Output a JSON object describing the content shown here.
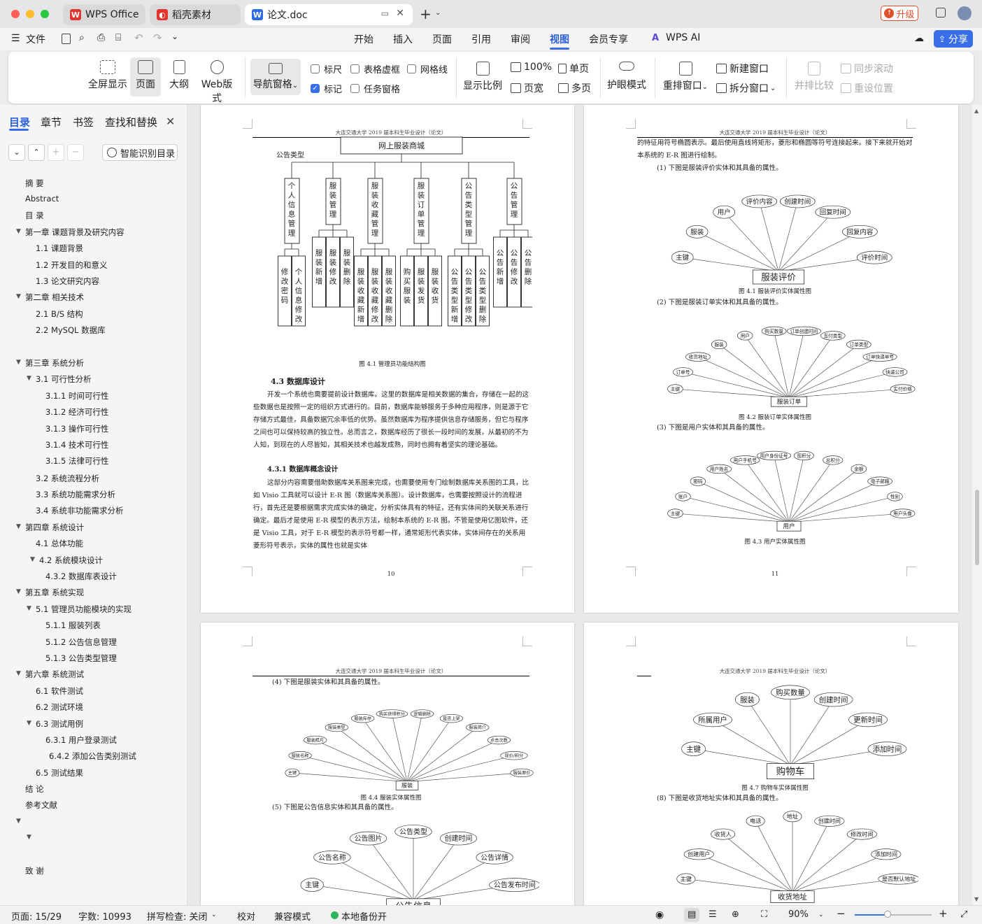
{
  "tabs": [
    {
      "label": "WPS Office"
    },
    {
      "label": "稻壳素材"
    },
    {
      "label": "论文.doc"
    }
  ],
  "upgrade_label": "升级",
  "menu": {
    "file": "文件",
    "items": [
      "开始",
      "插入",
      "页面",
      "引用",
      "审阅",
      "视图",
      "会员专享"
    ],
    "wps_ai": "WPS AI",
    "share": "分享"
  },
  "ribbon": {
    "fullscreen": "全屏显示",
    "page": "页面",
    "outline": "大纲",
    "web": "Web版式",
    "navpane": "导航窗格",
    "ruler": "标尺",
    "table_grid": "表格虚框",
    "gridlines": "网格线",
    "markup": "标记",
    "taskpane": "任务窗格",
    "zoom": "显示比例",
    "zoom100": "100%",
    "pagewidth": "页宽",
    "singlepage": "单页",
    "multipage": "多页",
    "eyecare": "护眼模式",
    "arrange": "重排窗口",
    "newwindow": "新建窗口",
    "split": "拆分窗口",
    "sidebyside": "并排比较",
    "syncscroll": "同步滚动",
    "resetpos": "重设位置"
  },
  "sidebar": {
    "tabs": [
      "目录",
      "章节",
      "书签",
      "查找和替换"
    ],
    "smart": "智能识别目录",
    "toc": [
      "摘 要",
      "Abstract",
      "目 录",
      "第一章 课题背景及研究内容",
      "1.1 课题背景",
      "1.2 开发目的和意义",
      "1.3 论文研究内容",
      "第二章 相关技术",
      "2.1 B/S 结构",
      "2.2 MySQL 数据库",
      "第三章 系统分析",
      "3.1 可行性分析",
      "3.1.1 时间可行性",
      "3.1.2 经济可行性",
      "3.1.3 操作可行性",
      "3.1.4 技术可行性",
      "3.1.5 法律可行性",
      "3.2 系统流程分析",
      "3.3 系统功能需求分析",
      "3.4 系统非功能需求分析",
      "第四章 系统设计",
      "4.1 总体功能",
      "4.2 系统模块设计",
      "4.3.2 数据库表设计",
      "第五章 系统实现",
      "5.1 管理员功能模块的实现",
      "5.1.1 服装列表",
      "5.1.2 公告信息管理",
      "5.1.3 公告类型管理",
      "第六章 系统测试",
      "6.1 软件测试",
      "6.2 测试环境",
      "6.3 测试用例",
      "6.3.1 用户登录测试",
      "6.4.2 添加公告类别测试",
      "6.5 测试结果",
      "结 论",
      "参考文献",
      "致 谢"
    ]
  },
  "doc": {
    "header": "大连交通大学 2019 届本科生毕业设计（论文）",
    "p10": {
      "chart_root": "网上服装商城",
      "chart_label": "公告类型",
      "modules": [
        "个人信息管理",
        "服装管理",
        "服装收藏管理",
        "服装订单管理",
        "公告类型管理",
        "公告管理"
      ],
      "subs": [
        [
          "修改密码",
          "个人信息修改"
        ],
        [
          "服装新增",
          "服装修改",
          "服装删除"
        ],
        [
          "服装收藏新增",
          "服装收藏修改",
          "服装收藏删除"
        ],
        [
          "购买服装",
          "服装发货",
          "服装收货"
        ],
        [
          "公告类型新增",
          "公告类型修改",
          "公告类型删除"
        ],
        [
          "公告新增",
          "公告修改",
          "公告删除"
        ]
      ],
      "fig_caption": "图 4.1 管理员功能结构图",
      "section": "4.3 数据库设计",
      "para1": "开发一个系统也需要提前设计数据库。这里的数据库是相关数据的集合，存储在一起的这些数据也是按照一定的组织方式进行的。目前，数据库能够服务于多种应用程序，则是源于它存储方式最佳，具备数据冗余率低的优势。虽然数据库为程序提供信息存储服务，但它与程序之间也可以保持较高的独立性。总而言之，数据库经历了很长一段时间的发展，从最初的不为人知，到现在的人尽皆知，其相关技术也越发成熟，同时也拥有着坚实的理论基础。",
      "subsection": "4.3.1 数据库概念设计",
      "para2": "这部分内容需要借助数据库关系图来完成，也需要使用专门绘制数据库关系图的工具，比如 Visio 工具就可以设计 E-R 图（数据库关系图）。设计数据库，也需要按照设计的流程进行，首先还是要根据需求完成实体的确定，分析实体具有的特征，还有实体间的关联关系进行确定。最后才是使用 E-R 模型的表示方法，绘制本系统的 E-R 图。不管是使用亿图软件，还是 Visio 工具，对于 E-R 模型的表示符号都一样，通常矩形代表实体，实体间存在的关系用菱形符号表示，实体的属性也就是实体",
      "page_no": "10"
    },
    "p11": {
      "para": "的特征用符号椭圆表示。最后使用直线将矩形，菱形和椭圆等符号连接起来。接下来就开始对本系统的 E-R 图进行绘制。",
      "s1": "(1) 下图是服装评价实体和其具备的属性。",
      "er1": {
        "entity": "服装评价",
        "attrs": [
          "主键",
          "服装",
          "用户",
          "评价内容",
          "创建时间",
          "回复时间",
          "回复内容",
          "评价时间"
        ]
      },
      "cap1": "图 4.1 服装评价实体属性图",
      "s2": "(2) 下图是服装订单实体和其具备的属性。",
      "er2": {
        "entity": "服装订单",
        "attrs": [
          "主键",
          "订单号",
          "收货地址",
          "服装",
          "用户",
          "购买数量",
          "订单创建时间",
          "支付类型",
          "订单类型",
          "订单快递单号",
          "快递公司",
          "实付价格"
        ]
      },
      "cap2": "图 4.2 服装订单实体属性图",
      "s3": "(3) 下图是用户实体和其具备的属性。",
      "er3": {
        "entity": "用户",
        "attrs": [
          "主键",
          "账户",
          "密码",
          "用户姓名",
          "用户手机号",
          "用户身份证号",
          "现积分",
          "总积分",
          "余额",
          "电子邮箱",
          "性别",
          "用户头像"
        ]
      },
      "cap3": "图 4.3 用户实体属性图",
      "page_no": "11"
    },
    "p12": {
      "s4": "(4) 下图是服装实体和其具备的属性。",
      "er4": {
        "entity": "服装",
        "attrs": [
          "主键",
          "服装名称",
          "服装照片",
          "服装类型",
          "服装库存",
          "购买获得积分",
          "逻辑删除",
          "是否上架",
          "服装简介",
          "点击次数",
          "现价/积分",
          "服装原价"
        ]
      },
      "cap4": "图 4.4 服装实体属性图",
      "s5": "(5) 下图是公告信息实体和其具备的属性。",
      "er5": {
        "entity": "公告信息",
        "attrs": [
          "主键",
          "公告名称",
          "公告图片",
          "公告类型",
          "创建时间",
          "公告详情",
          "公告发布时间"
        ]
      }
    },
    "p13": {
      "er7": {
        "entity": "购物车",
        "attrs": [
          "主键",
          "所属用户",
          "服装",
          "购买数量",
          "创建时间",
          "更新时间",
          "添加时间"
        ]
      },
      "cap7": "图 4.7 购物车实体属性图",
      "s8": "(8) 下图是收货地址实体和其具备的属性。",
      "er8": {
        "entity": "收货地址",
        "attrs": [
          "主键",
          "创建用户",
          "收货人",
          "电话",
          "地址",
          "创建时间",
          "修改时间",
          "添加时间",
          "是否默认地址"
        ]
      }
    }
  },
  "status": {
    "page": "页面: 15/29",
    "words": "字数: 10993",
    "spell": "拼写检查: 关闭",
    "proof": "校对",
    "compat": "兼容模式",
    "backup": "本地备份开",
    "zoom": "90%"
  },
  "colors": {
    "accent": "#3a6ee8",
    "upgrade": "#e0502a",
    "wps_red": "#e3342f"
  }
}
